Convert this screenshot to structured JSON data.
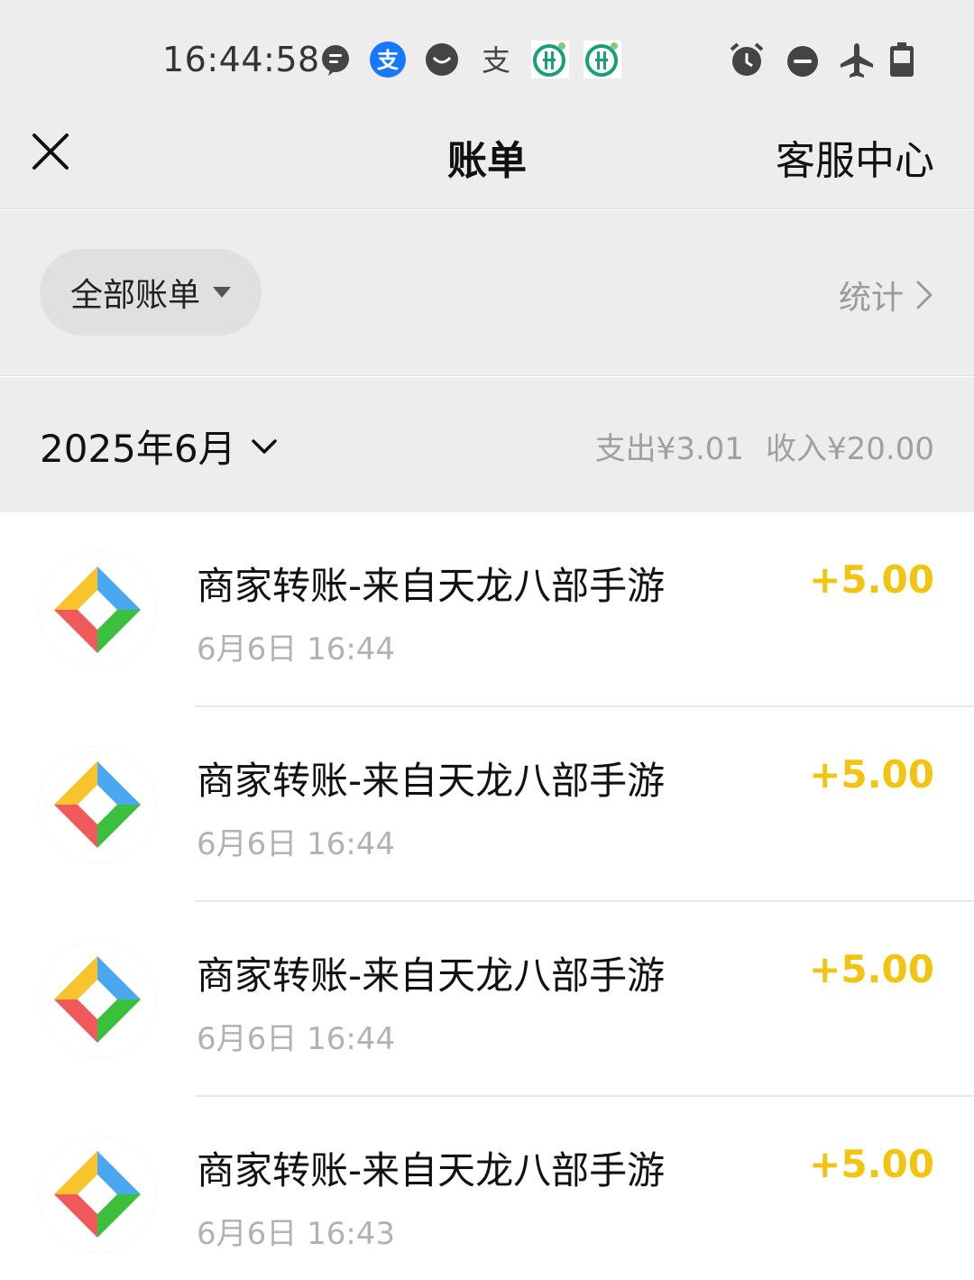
{
  "status_bar": {
    "time": "16:44:58",
    "left_icons": [
      "chat-bubble-icon",
      "alipay-icon",
      "mask-app-icon",
      "alipay-outline-icon",
      "bank-icon",
      "bank-icon"
    ],
    "right_icons": [
      "alarm-icon",
      "do-not-disturb-icon",
      "airplane-mode-icon",
      "battery-icon"
    ]
  },
  "nav": {
    "close_icon": "close-icon",
    "title": "账单",
    "service_label": "客服中心"
  },
  "filter": {
    "selected": "全部账单",
    "stats_label": "统计"
  },
  "month": {
    "label": "2025年6月",
    "expense": "支出¥3.01",
    "income": "收入¥20.00"
  },
  "transactions": [
    {
      "title": "商家转账-来自天龙八部手游",
      "time": "6月6日 16:44",
      "amount": "+5.00",
      "icon": "merchant-logo-icon"
    },
    {
      "title": "商家转账-来自天龙八部手游",
      "time": "6月6日 16:44",
      "amount": "+5.00",
      "icon": "merchant-logo-icon"
    },
    {
      "title": "商家转账-来自天龙八部手游",
      "time": "6月6日 16:44",
      "amount": "+5.00",
      "icon": "merchant-logo-icon"
    },
    {
      "title": "商家转账-来自天龙八部手游",
      "time": "6月6日 16:43",
      "amount": "+5.00",
      "icon": "merchant-logo-icon"
    }
  ],
  "colors": {
    "header_bg": "#ededed",
    "income_amount": "#f1c40f",
    "logo_yellow": "#f7c52b",
    "logo_blue": "#4aa8f0",
    "logo_red": "#f05a5a",
    "logo_green": "#3cbf3c"
  }
}
